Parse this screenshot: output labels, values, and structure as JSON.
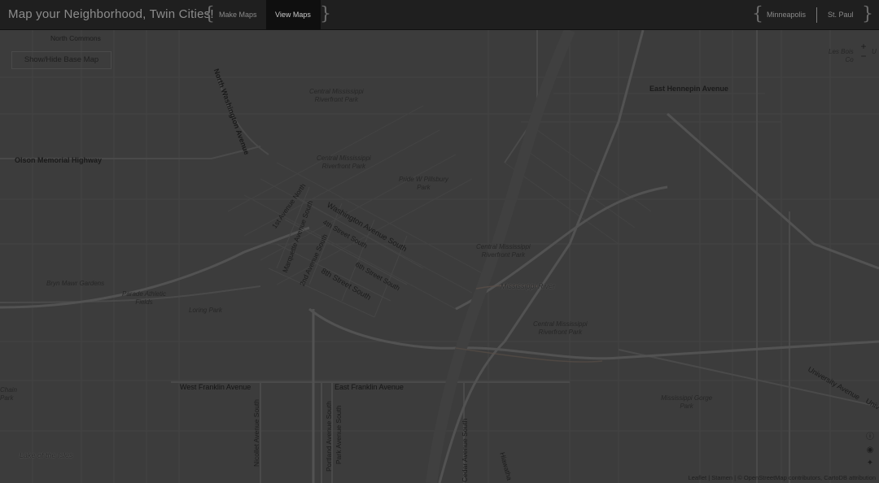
{
  "header": {
    "title": "Map your Neighborhood, Twin Cities!",
    "brace_open": "{",
    "brace_close": "}",
    "nav": [
      {
        "label": "Make Maps",
        "active": false
      },
      {
        "label": "View Maps",
        "active": true
      }
    ],
    "cities": [
      {
        "label": "Minneapolis"
      },
      {
        "label": "St. Paul"
      }
    ]
  },
  "map": {
    "basemap_button": "Show/Hide Base Map",
    "zoom_in": "+",
    "zoom_out": "−",
    "labels": {
      "north_commons": "North Commons",
      "north_washington": "North Washington Avenue",
      "east_hennepin": "East Hennepin Avenue",
      "olson": "Olson Memorial Highway",
      "cm_park_1": "Central Mississippi\nRiverfront Park",
      "cm_park_2": "Central Mississippi\nRiverfront Park",
      "cm_park_3": "Central Mississippi\nRiverfront Park",
      "cm_park_4": "Central Mississippi\nRiverfront Park",
      "pillsbury": "Pride W Pillsbury\nPark",
      "first_ave": "1st Avenue North",
      "washington_s": "Washington Avenue South",
      "fourth_st": "4th Street South",
      "marquette": "Marquette Avenue South",
      "second_ave": "2nd Avenue South",
      "sixth_st": "6th Street South",
      "eighth_st": "8th Street South",
      "mississippi": "Mississippi River",
      "bryn_mawr": "Bryn Mawr Gardens",
      "parade": "Parade Athletic\nFields",
      "loring": "Loring Park",
      "w_franklin": "West Franklin Avenue",
      "e_franklin": "East Franklin Avenue",
      "nicollet": "Nicollet Avenue South",
      "portland": "Portland Avenue South",
      "park_ave": "Park Avenue South",
      "cedar": "Cedar Avenue South",
      "hiawatha": "Hiawatha",
      "university": "University Avenue",
      "univ_cut": "Univ",
      "gorge": "Mississippi Gorge\nPark",
      "lake_isles": "Lake of the Isles",
      "chain": "Chain\nPark",
      "les_bois": "Les Bois\nCo",
      "edge_u": "U"
    },
    "social": [
      "info-icon",
      "github-icon",
      "twitter-icon"
    ],
    "attribution": {
      "leaflet": "Leaflet",
      "sep1": " | ",
      "stamen": "Stamen",
      "sep2": " | © ",
      "osm": "OpenStreetMap contributors",
      "sep3": ", ",
      "cartodb": "CartoDB attribution"
    }
  }
}
